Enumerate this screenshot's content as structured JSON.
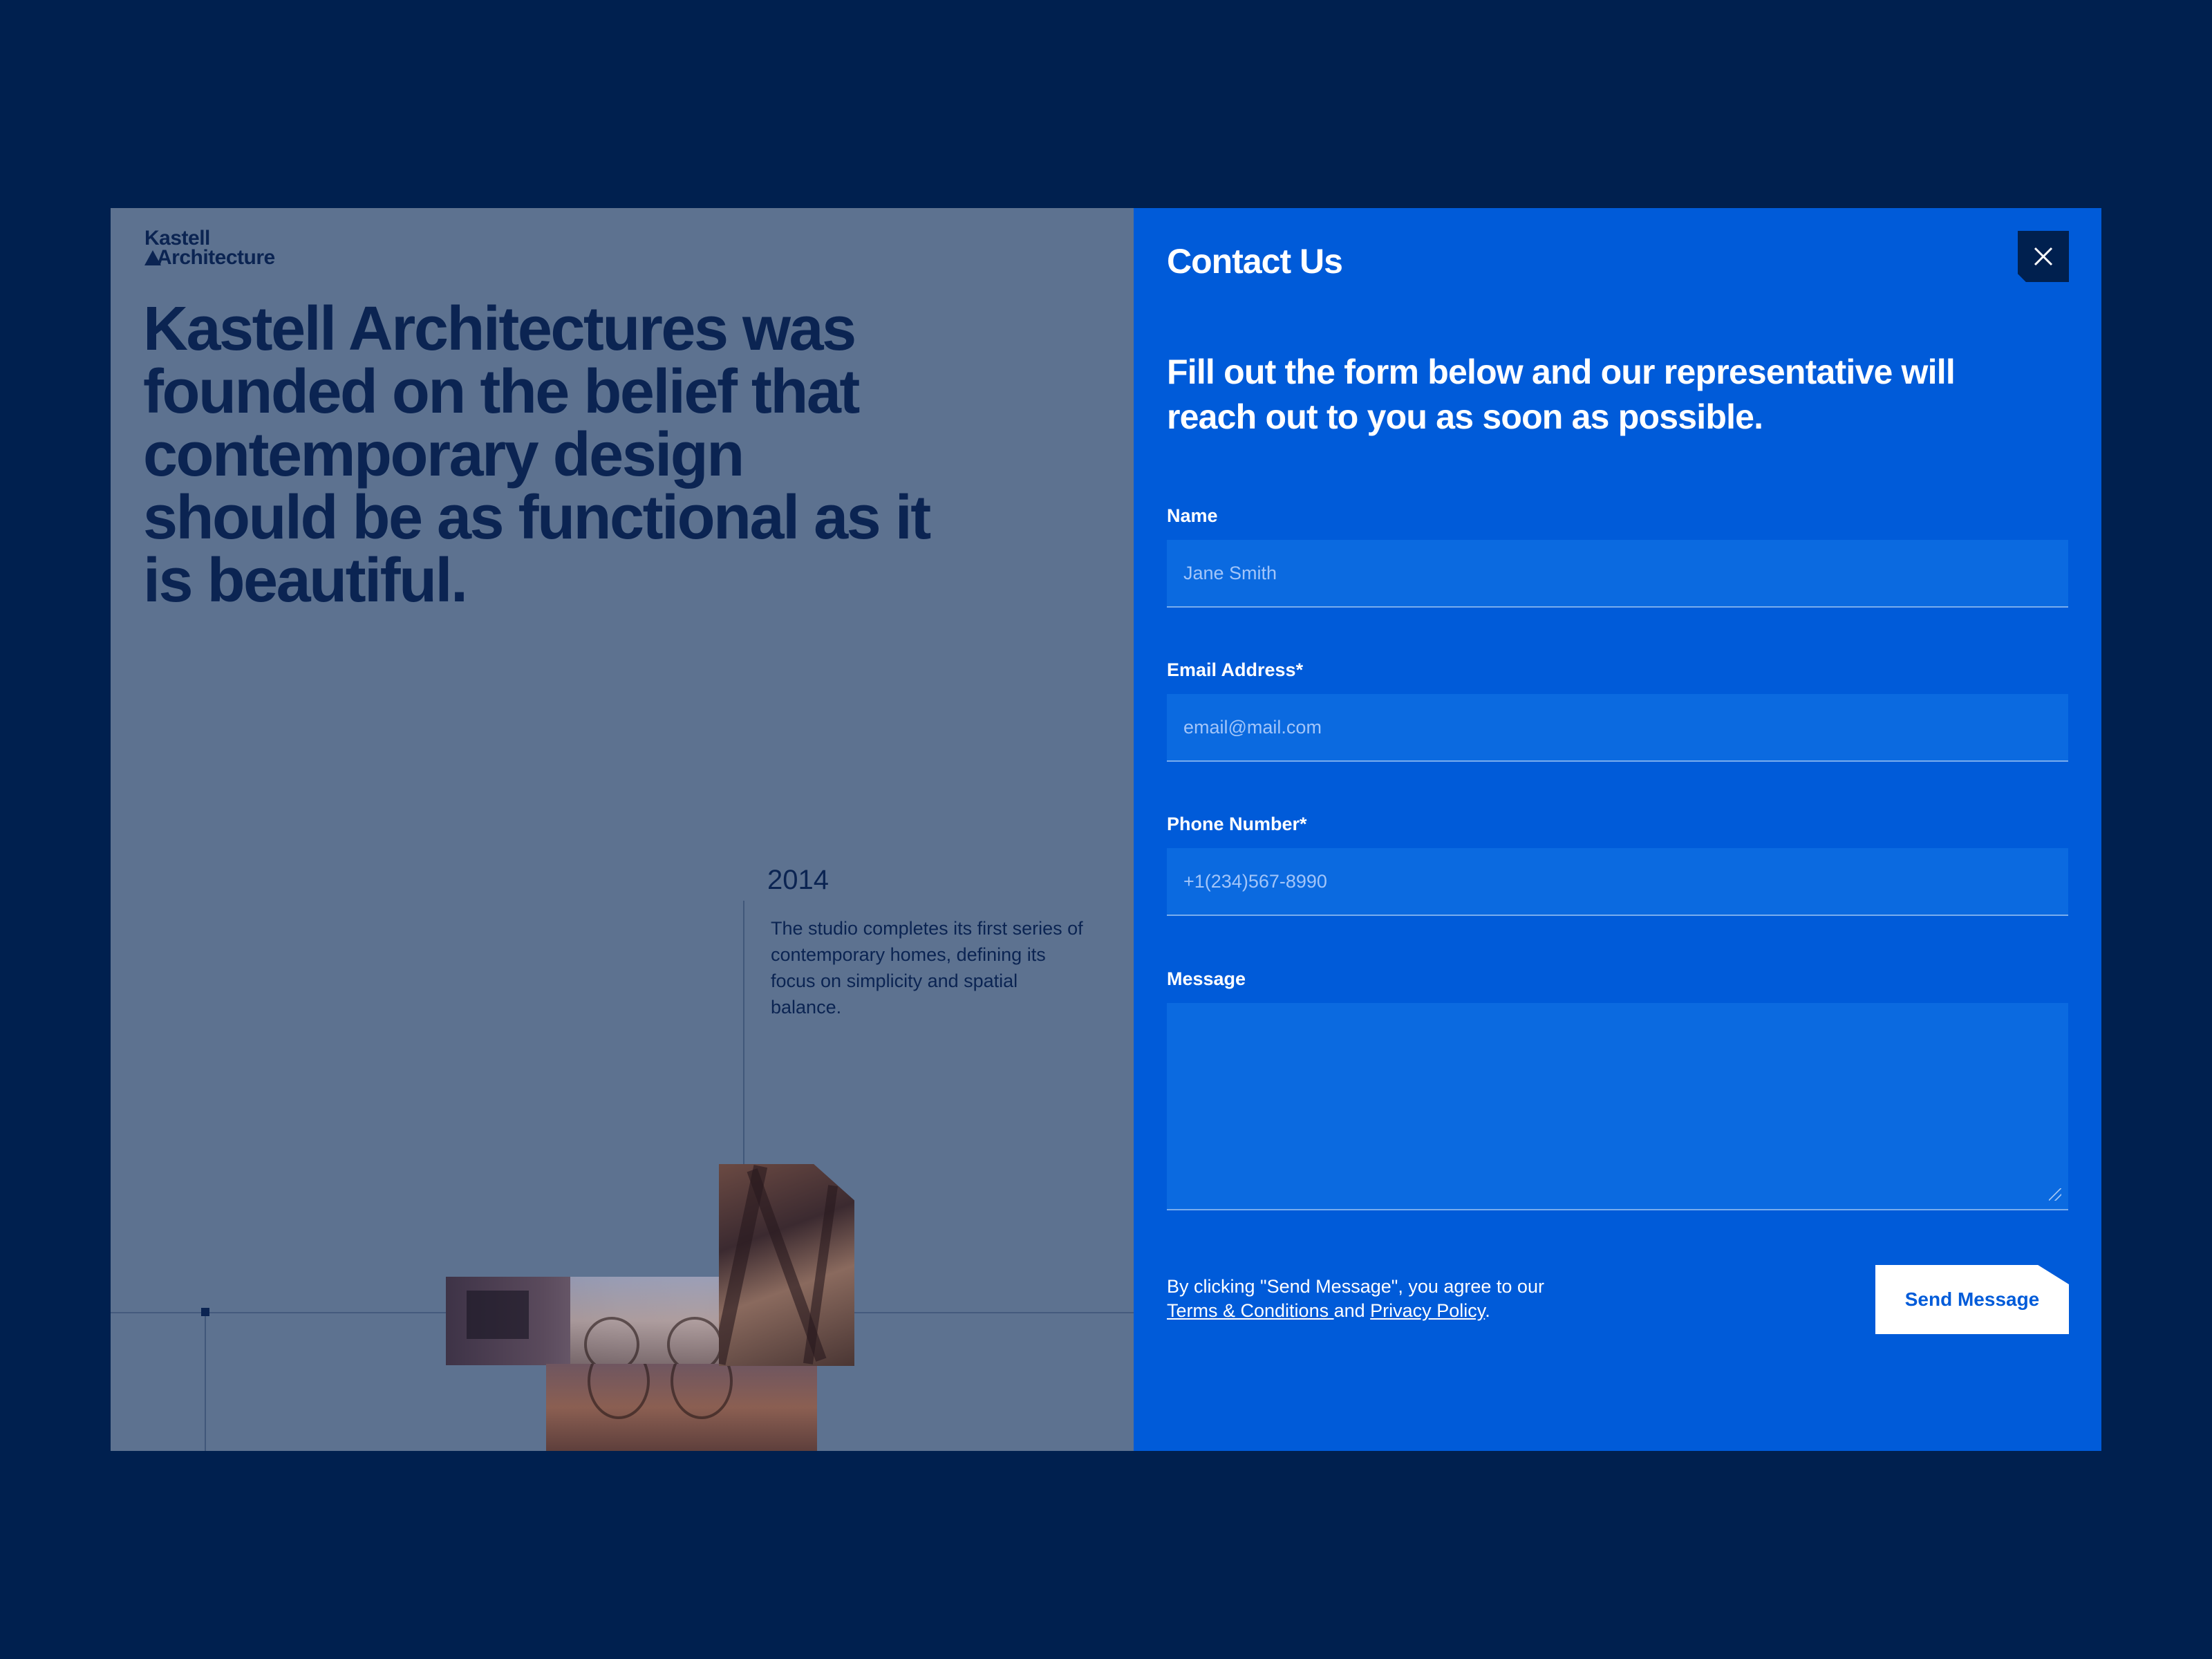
{
  "brand": {
    "line1": "Kastell",
    "line2": "Architecture"
  },
  "hero": {
    "headline": "Kastell Architectures was founded on the belief that contemporary design should be as functional as it is beautiful."
  },
  "timeline": {
    "year": "2014",
    "description": "The studio completes its first series of contemporary homes, defining its focus on simplicity and spatial balance."
  },
  "contact": {
    "title": "Contact Us",
    "intro": "Fill out the form below and our representative will reach out to you as soon as possible.",
    "fields": {
      "name": {
        "label": "Name",
        "placeholder": "Jane Smith"
      },
      "email": {
        "label": "Email Address*",
        "placeholder": "email@mail.com"
      },
      "phone": {
        "label": "Phone Number*",
        "placeholder": "+1(234)567-8990"
      },
      "message": {
        "label": "Message",
        "placeholder": ""
      }
    },
    "agreement": {
      "prefix": "By clicking \"Send Message\", you agree to our",
      "terms_link": "Terms & Conditions ",
      "middle": "and",
      "privacy_link": "Privacy Policy",
      "suffix": "."
    },
    "submit_label": "Send Message",
    "close_icon": "close-icon"
  },
  "colors": {
    "background": "#00204f",
    "left_panel": "#5d7290",
    "accent": "#005bd9",
    "text_dark": "#0b2452"
  }
}
